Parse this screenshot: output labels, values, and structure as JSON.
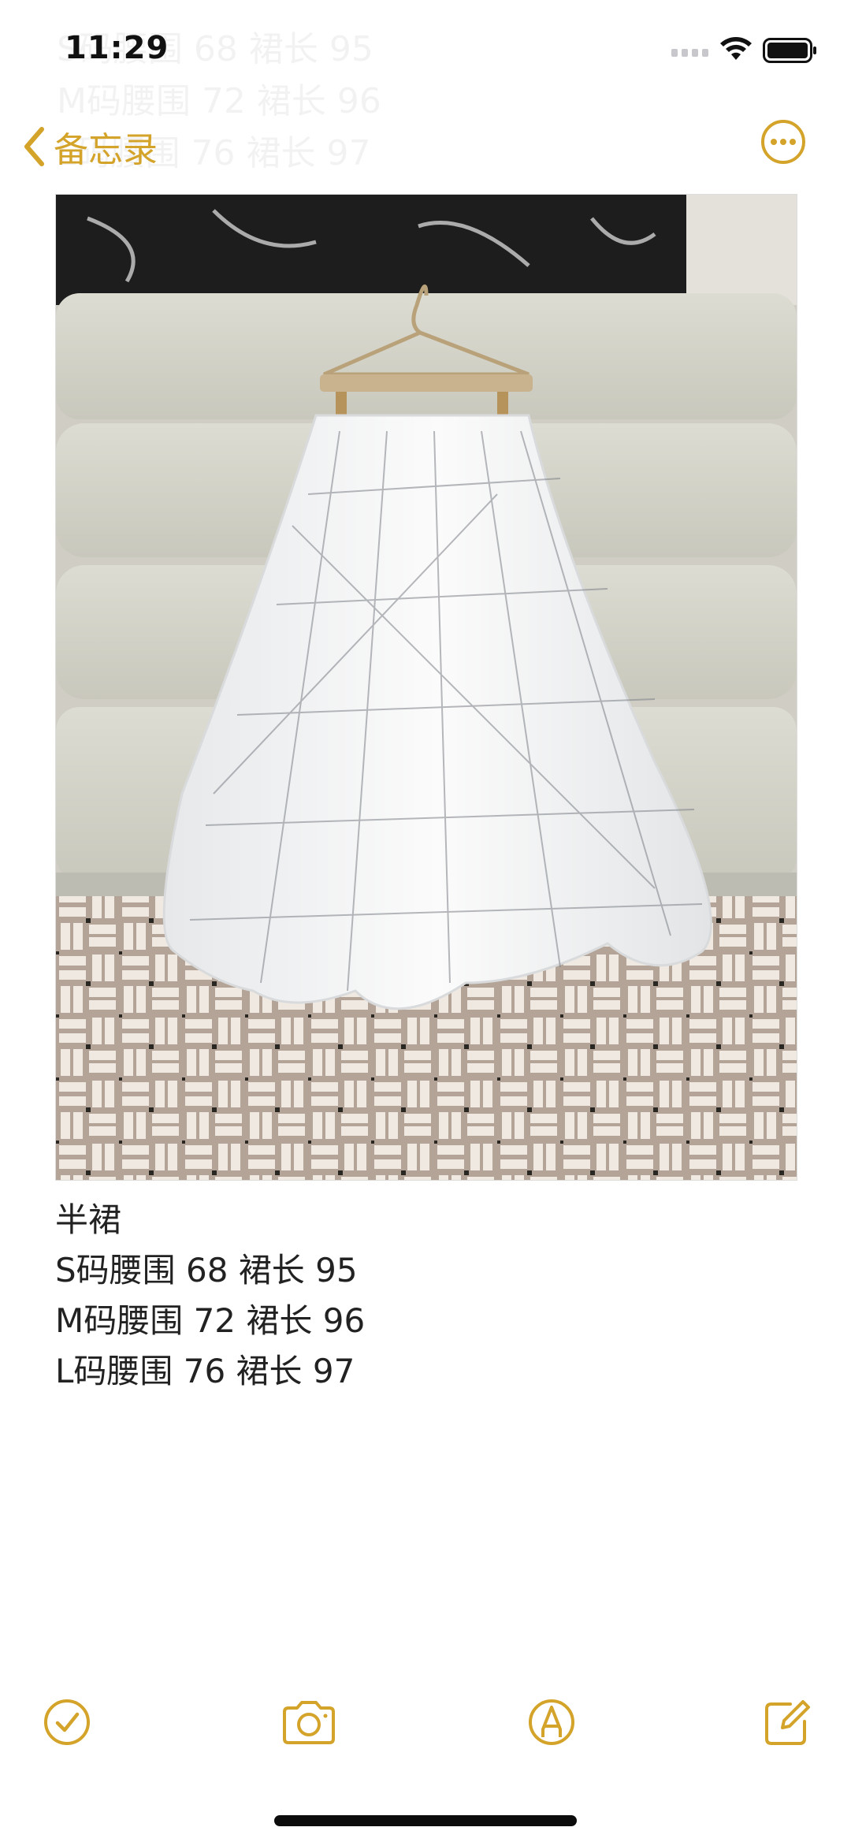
{
  "status": {
    "time": "11:29"
  },
  "nav": {
    "back_label": "备忘录",
    "more_icon": "ellipsis-circle-icon",
    "accent_color": "#d4a32a"
  },
  "note": {
    "title": "半裙",
    "lines": [
      "S码腰围 68 裙长 95",
      "M码腰围 72 裙长 96",
      "L码腰围 76 裙长 97"
    ]
  },
  "toolbar": {
    "items": [
      "checklist-icon",
      "camera-icon",
      "markup-icon",
      "compose-icon"
    ]
  }
}
